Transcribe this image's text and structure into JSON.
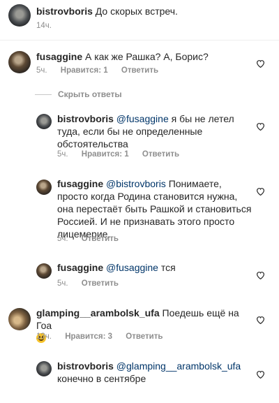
{
  "comments": [
    {
      "user": "bistrovboris",
      "text": "До скорых встреч.",
      "time": "14ч."
    },
    {
      "user": "fusaggine",
      "text": "А как же Рашка? А, Борис?",
      "time": "5ч.",
      "likes": "Нравится: 1",
      "reply": "Ответить"
    },
    {
      "user": "bistrovboris",
      "mention": "@fusaggine",
      "text_line1": " я бы не летел",
      "text_line2": "туда, если бы не определенные",
      "text_line3": "обстоятельства",
      "time": "5ч.",
      "likes": "Нравится: 1",
      "reply": "Ответить"
    },
    {
      "user": "fusaggine",
      "mention": "@bistrovboris",
      "text_line1": " Понимаете,",
      "text_line2": "просто когда Родина становится нужна,",
      "text_line3": "она перестаёт быть Рашкой и становиться",
      "text_line4": "Россией. И не признавать этого просто",
      "text_line5": "лицемерие.",
      "time": "5ч.",
      "reply": "Ответить"
    },
    {
      "user": "fusaggine",
      "mention": "@fusaggine",
      "text": " тся",
      "time": "5ч.",
      "reply": "Ответить"
    },
    {
      "user": "glamping__arambolsk_ufa",
      "text": " Поедешь ещё на Гоа",
      "emoji": "smiling-face-emoji",
      "time": "13ч.",
      "likes": "Нравится: 3",
      "reply": "Ответить"
    },
    {
      "user": "bistrovboris",
      "mention": "@glamping__arambolsk_ufa",
      "text_line2": "конечно в сентябре"
    }
  ],
  "hide_replies": "Скрыть ответы",
  "colors": {
    "text": "#262626",
    "meta": "#8e8e8e",
    "mention": "#003569",
    "divider": "#efefef"
  }
}
